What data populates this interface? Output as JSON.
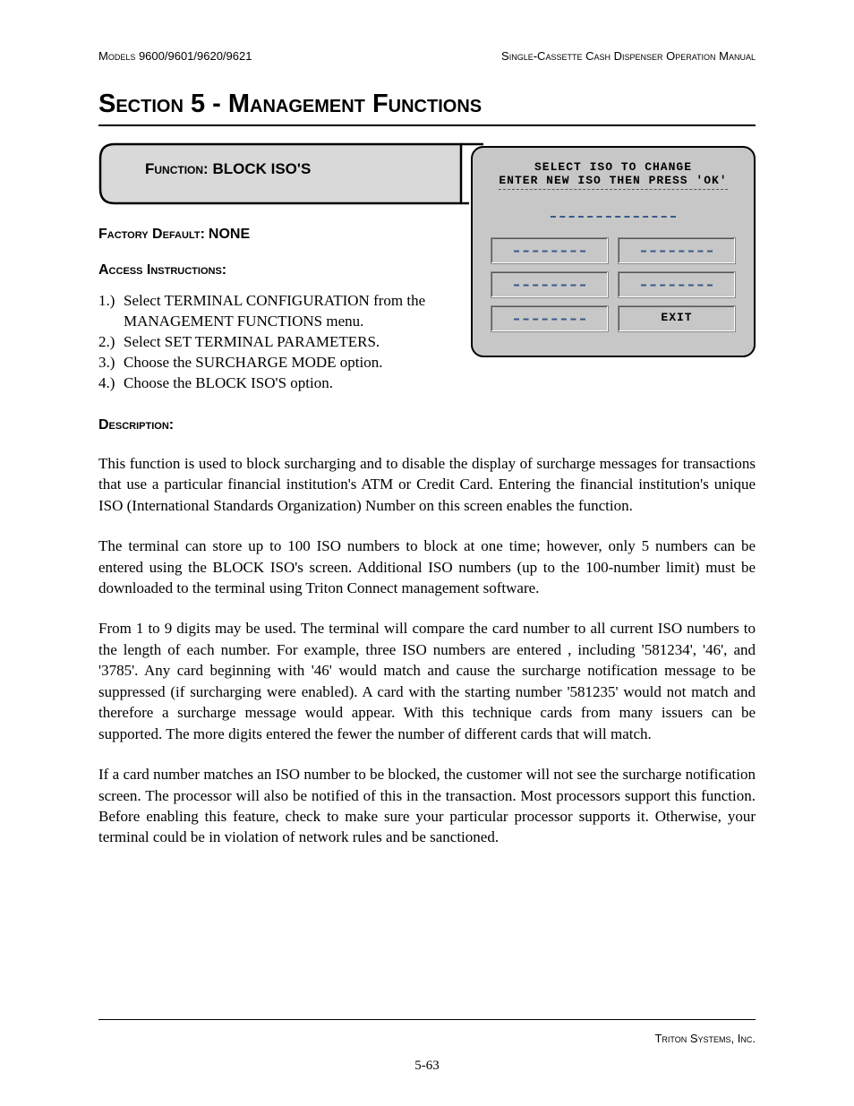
{
  "header": {
    "left": "Models 9600/9601/9620/9621",
    "right": "Single-Cassette Cash Dispenser Operation Manual"
  },
  "section_title": "Section 5 - Management Functions",
  "function_bar": {
    "label_prefix": "Function:",
    "label_value": "BLOCK ISO'S"
  },
  "screenshot": {
    "line1": "SELECT ISO TO CHANGE",
    "line2": "ENTER NEW ISO THEN PRESS 'OK'",
    "exit": "EXIT"
  },
  "factory_default": {
    "label": "Factory Default:",
    "value": "NONE"
  },
  "access_instructions_label": "Access Instructions:",
  "instructions": [
    "Select TERMINAL CONFIGURATION from the MANAGEMENT FUNCTIONS menu.",
    "Select SET TERMINAL PARAMETERS.",
    "Choose the SURCHARGE MODE option.",
    "Choose the BLOCK ISO'S option."
  ],
  "description_label": "Description:",
  "paragraphs": [
    "This function is used to block surcharging and to disable the display of surcharge messages for transactions that use a particular financial institution's ATM or Credit Card.  Entering the financial institution's unique ISO (International Standards Organization) Number on this screen enables the function.",
    "The terminal can store up to 100 ISO numbers to block at one time; however, only 5 numbers can be entered using the BLOCK ISO's screen. Additional ISO numbers (up to the 100-number limit) must be downloaded to the terminal using Triton Connect management software.",
    "From 1 to 9 digits may be used.  The terminal will compare the card number to all current ISO numbers to the length of each number.  For example, three ISO numbers are entered , including '581234', '46', and '3785'.  Any card beginning with '46' would match and cause the surcharge notification message to be suppressed (if surcharging were enabled).  A card with the starting number '581235' would not match and therefore a surcharge message would appear.  With this technique cards from many issuers can be supported.  The more digits entered the fewer the number of different cards that will match.",
    "If a card number matches an ISO number to be blocked, the customer will not see the surcharge notification screen.  The processor will also be notified of this in the transaction.  Most processors support this function.  Before enabling this feature, check to make sure your particular processor supports it.  Otherwise, your terminal could be in violation of network rules and be sanctioned."
  ],
  "footer": {
    "company": "Triton Systems, Inc.",
    "page": "5-63"
  }
}
